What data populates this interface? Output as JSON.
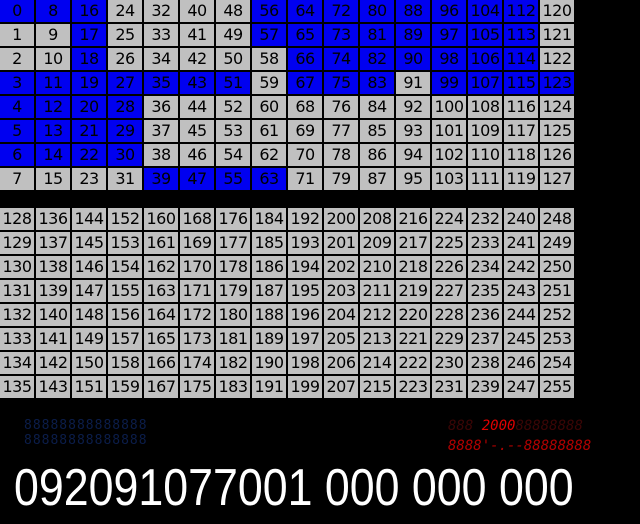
{
  "colors": {
    "cell_off": "#c0c0c0",
    "cell_on": "#0000f0",
    "background": "#000000"
  },
  "top_grid": {
    "rows": [
      [
        "0",
        "8",
        "16",
        "24",
        "32",
        "40",
        "48",
        "56",
        "64",
        "72",
        "80",
        "88",
        "96",
        "104",
        "112",
        "120"
      ],
      [
        "1",
        "9",
        "17",
        "25",
        "33",
        "41",
        "49",
        "57",
        "65",
        "73",
        "81",
        "89",
        "97",
        "105",
        "113",
        "121"
      ],
      [
        "2",
        "10",
        "18",
        "26",
        "34",
        "42",
        "50",
        "58",
        "66",
        "74",
        "82",
        "90",
        "98",
        "106",
        "114",
        "122"
      ],
      [
        "3",
        "11",
        "19",
        "27",
        "35",
        "43",
        "51",
        "59",
        "67",
        "75",
        "83",
        "91",
        "99",
        "107",
        "115",
        "123"
      ],
      [
        "4",
        "12",
        "20",
        "28",
        "36",
        "44",
        "52",
        "60",
        "68",
        "76",
        "84",
        "92",
        "100",
        "108",
        "116",
        "124"
      ],
      [
        "5",
        "13",
        "21",
        "29",
        "37",
        "45",
        "53",
        "61",
        "69",
        "77",
        "85",
        "93",
        "101",
        "109",
        "117",
        "125"
      ],
      [
        "6",
        "14",
        "22",
        "30",
        "38",
        "46",
        "54",
        "62",
        "70",
        "78",
        "86",
        "94",
        "102",
        "110",
        "118",
        "126"
      ],
      [
        "7",
        "15",
        "23",
        "31",
        "39",
        "47",
        "55",
        "63",
        "71",
        "79",
        "87",
        "95",
        "103",
        "111",
        "119",
        "127"
      ]
    ],
    "highlighted": [
      [
        1,
        1,
        1,
        0,
        0,
        0,
        0,
        1,
        1,
        1,
        1,
        1,
        1,
        1,
        1,
        0
      ],
      [
        0,
        0,
        1,
        0,
        0,
        0,
        0,
        1,
        1,
        1,
        1,
        1,
        1,
        1,
        1,
        0
      ],
      [
        0,
        0,
        1,
        0,
        0,
        0,
        0,
        0,
        1,
        1,
        1,
        1,
        1,
        1,
        1,
        0
      ],
      [
        1,
        1,
        1,
        1,
        1,
        1,
        1,
        0,
        1,
        1,
        1,
        0,
        1,
        1,
        1,
        1
      ],
      [
        1,
        1,
        1,
        1,
        0,
        0,
        0,
        0,
        0,
        0,
        0,
        0,
        0,
        0,
        0,
        0
      ],
      [
        1,
        1,
        1,
        1,
        0,
        0,
        0,
        0,
        0,
        0,
        0,
        0,
        0,
        0,
        0,
        0
      ],
      [
        1,
        1,
        1,
        1,
        0,
        0,
        0,
        0,
        0,
        0,
        0,
        0,
        0,
        0,
        0,
        0
      ],
      [
        0,
        0,
        0,
        0,
        1,
        1,
        1,
        1,
        0,
        0,
        0,
        0,
        0,
        0,
        0,
        0
      ]
    ]
  },
  "bottom_grid": {
    "rows": [
      [
        "128",
        "136",
        "144",
        "152",
        "160",
        "168",
        "176",
        "184",
        "192",
        "200",
        "208",
        "216",
        "224",
        "232",
        "240",
        "248"
      ],
      [
        "129",
        "137",
        "145",
        "153",
        "161",
        "169",
        "177",
        "185",
        "193",
        "201",
        "209",
        "217",
        "225",
        "233",
        "241",
        "249"
      ],
      [
        "130",
        "138",
        "146",
        "154",
        "162",
        "170",
        "178",
        "186",
        "194",
        "202",
        "210",
        "218",
        "226",
        "234",
        "242",
        "250"
      ],
      [
        "131",
        "139",
        "147",
        "155",
        "163",
        "171",
        "179",
        "187",
        "195",
        "203",
        "211",
        "219",
        "227",
        "235",
        "243",
        "251"
      ],
      [
        "132",
        "140",
        "148",
        "156",
        "164",
        "172",
        "180",
        "188",
        "196",
        "204",
        "212",
        "220",
        "228",
        "236",
        "244",
        "252"
      ],
      [
        "133",
        "141",
        "149",
        "157",
        "165",
        "173",
        "181",
        "189",
        "197",
        "205",
        "213",
        "221",
        "229",
        "237",
        "245",
        "253"
      ],
      [
        "134",
        "142",
        "150",
        "158",
        "166",
        "174",
        "182",
        "190",
        "198",
        "206",
        "214",
        "222",
        "230",
        "238",
        "246",
        "254"
      ],
      [
        "135",
        "143",
        "151",
        "159",
        "167",
        "175",
        "183",
        "191",
        "199",
        "207",
        "215",
        "223",
        "231",
        "239",
        "247",
        "255"
      ]
    ]
  },
  "seg_display_left": {
    "row1": "88888888888888",
    "row2": "88888888888888"
  },
  "seg_display_right": {
    "row1_pre": "888 ",
    "row1_value": "2000",
    "row1_post": "88888888",
    "row2": "8888'-.--88888888"
  },
  "counter": {
    "text": "092091077001 000 000 000"
  }
}
